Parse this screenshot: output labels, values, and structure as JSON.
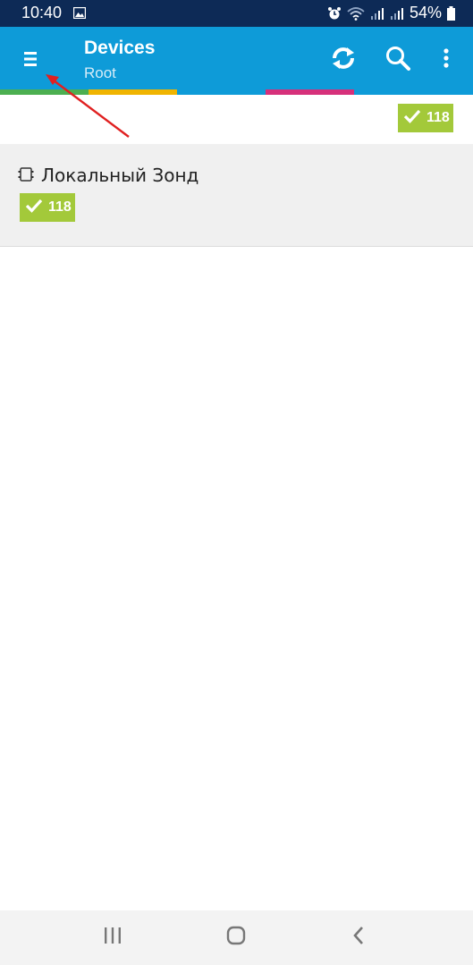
{
  "status_bar": {
    "time": "10:40",
    "battery": "54%",
    "icons": [
      "gallery-icon",
      "alarm-icon",
      "wifi-icon",
      "signal-icon",
      "signal-icon",
      "battery-icon"
    ]
  },
  "app_bar": {
    "title": "Devices",
    "subtitle": "Root",
    "icons": [
      "menu-icon",
      "refresh-icon",
      "search-icon",
      "more-vert-icon"
    ],
    "color": "#0e9bd8"
  },
  "status_strip": {
    "colors": [
      "#4caf50",
      "#f0b400",
      "#0e9bd8",
      "#d6307a"
    ]
  },
  "summary": {
    "ok_count": "118",
    "badge_color": "#a3c93a"
  },
  "devices": [
    {
      "name": "Локальный Зонд",
      "icon": "probe-icon",
      "ok_count": "118"
    }
  ],
  "nav_bar": {
    "icons": [
      "recents-icon",
      "home-icon",
      "back-icon"
    ]
  }
}
